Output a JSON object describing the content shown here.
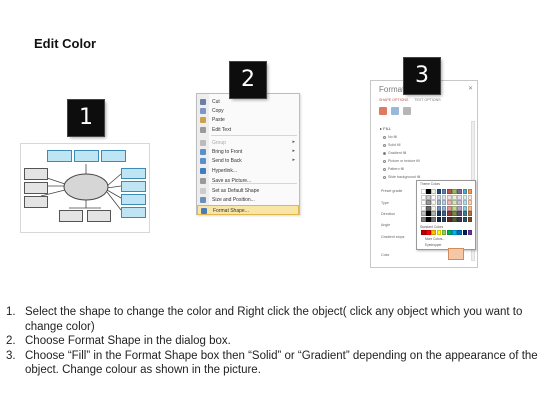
{
  "page": {
    "title": "Edit Color"
  },
  "badges": [
    "1",
    "2",
    "3"
  ],
  "context_menu": {
    "items": [
      {
        "label": "Cut",
        "icon": "scissors-icon",
        "color": "#6b7fa6",
        "dim": false,
        "arrow": false
      },
      {
        "label": "Copy",
        "icon": "copy-icon",
        "color": "#7f95c4",
        "dim": false,
        "arrow": false
      },
      {
        "label": "Paste",
        "icon": "paste-icon",
        "color": "#c9a24a",
        "dim": false,
        "arrow": false
      },
      {
        "label": "Edit Text",
        "icon": "edit-text-icon",
        "color": "#9a9a9a",
        "dim": false,
        "arrow": false
      },
      {
        "label": "Group",
        "icon": "group-icon",
        "color": "#bbbbbb",
        "dim": true,
        "arrow": true
      },
      {
        "label": "Bring to Front",
        "icon": "bring-to-front-icon",
        "color": "#5b8fc7",
        "dim": false,
        "arrow": true
      },
      {
        "label": "Send to Back",
        "icon": "send-to-back-icon",
        "color": "#5b8fc7",
        "dim": false,
        "arrow": true
      },
      {
        "label": "Hyperlink...",
        "icon": "hyperlink-icon",
        "color": "#3c7fc0",
        "dim": false,
        "arrow": false
      },
      {
        "label": "Save as Picture...",
        "icon": "picture-icon",
        "color": "#9a9a9a",
        "dim": false,
        "arrow": false
      },
      {
        "label": "Set as Default Shape",
        "icon": "default-shape-icon",
        "color": "#cccccc",
        "dim": false,
        "arrow": false
      },
      {
        "label": "Size and Position...",
        "icon": "size-position-icon",
        "color": "#6b8fb8",
        "dim": false,
        "arrow": false
      },
      {
        "label": "Format Shape...",
        "icon": "format-shape-icon",
        "color": "#4a7cb5",
        "dim": false,
        "arrow": false,
        "highlight": true
      }
    ]
  },
  "format_pane": {
    "title": "Format",
    "tabs": [
      "SHAPE OPTIONS",
      "TEXT OPTIONS"
    ],
    "section": "FILL",
    "fill_options": [
      "No fill",
      "Solid fill",
      "Gradient fill",
      "Picture or texture fill",
      "Pattern fill",
      "Slide background fill"
    ],
    "selected_fill": 2,
    "labels": [
      "Preset gradie",
      "Type",
      "Direction",
      "Angle",
      "Gradient stops",
      "Color"
    ],
    "palette": {
      "header": "Theme Colors",
      "standard_label": "Standard Colors",
      "more_colors": "More Colors...",
      "eyedropper": "Eyedropper",
      "theme_top": [
        "#ffffff",
        "#000000",
        "#eeece1",
        "#1f497d",
        "#4f81bd",
        "#c0504d",
        "#9bbb59",
        "#8064a2",
        "#4bacc6",
        "#f79646"
      ],
      "standard": [
        "#c00000",
        "#ff0000",
        "#ffc000",
        "#ffff00",
        "#92d050",
        "#00b050",
        "#00b0f0",
        "#0070c0",
        "#002060",
        "#7030a0"
      ]
    },
    "current_color": "#f4c7a6"
  },
  "instructions": [
    {
      "num": "1.",
      "text": "Select the shape to change the color and Right click the object( click any object which you want to change color)"
    },
    {
      "num": "2.",
      "text": "Choose Format Shape in the dialog box."
    },
    {
      "num": "3.",
      "text": "Choose “Fill” in the Format Shape box then “Solid” or “Gradient” depending on the appearance of the object. Change colour as shown in the picture."
    }
  ]
}
